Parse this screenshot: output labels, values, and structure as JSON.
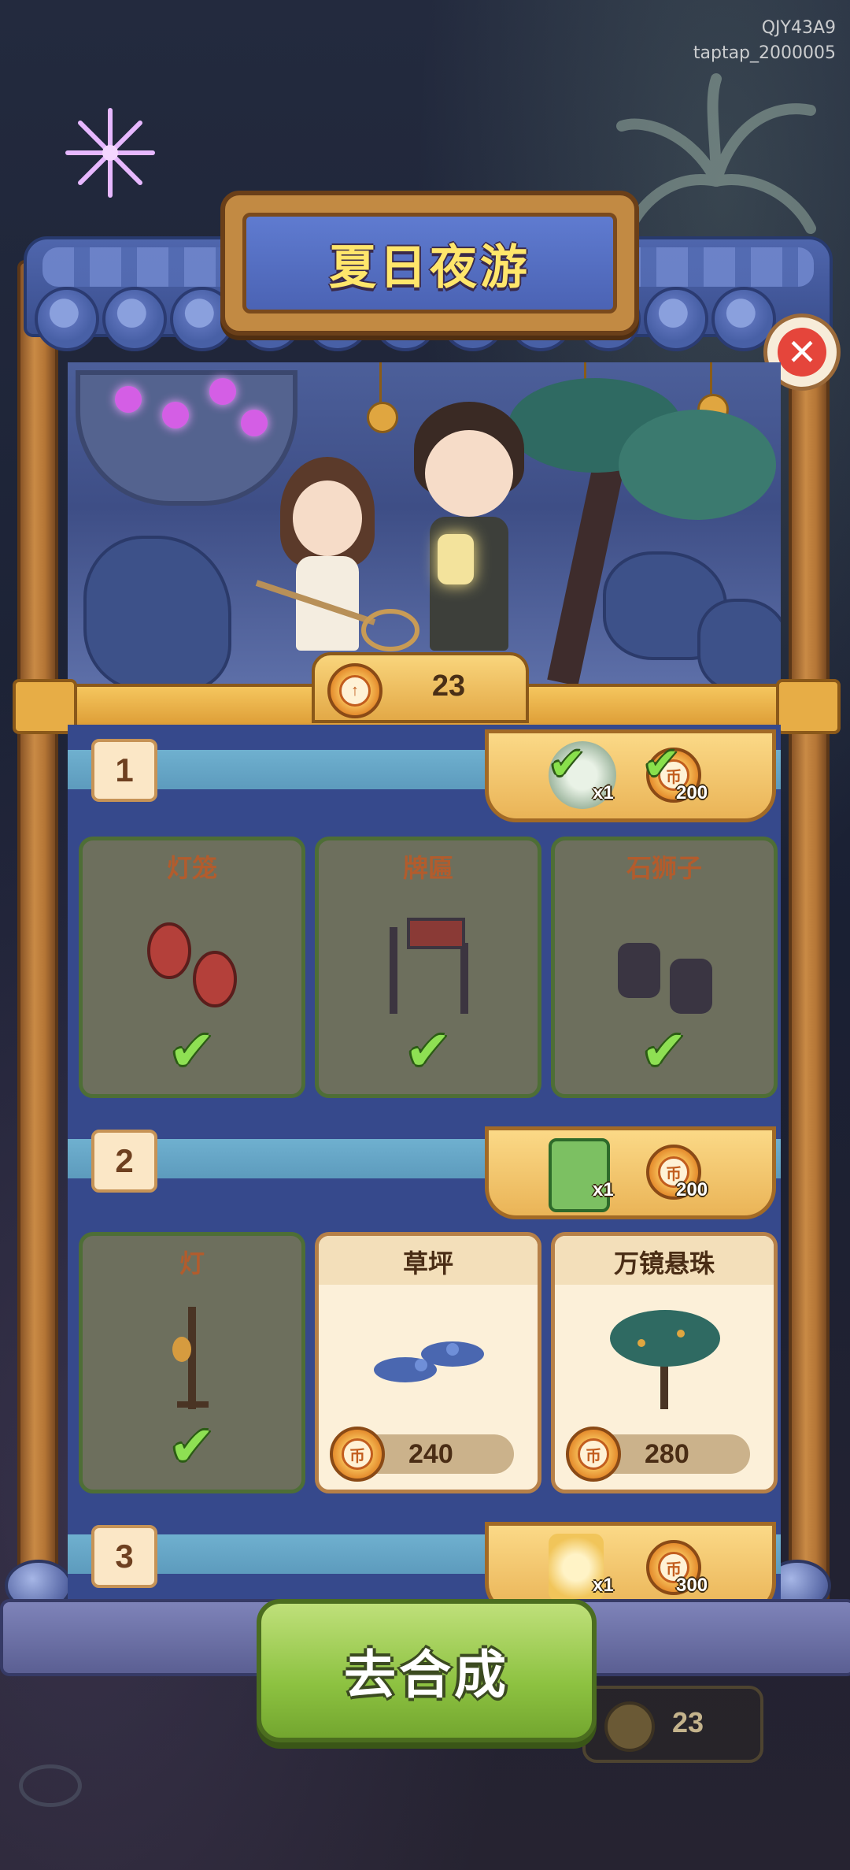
{
  "watermark": {
    "line1": "QJY43A9",
    "line2": "taptap_2000005"
  },
  "title": "夏日夜游",
  "counter": {
    "value": "23"
  },
  "rows": [
    {
      "number": "1",
      "reward": {
        "item_qty": "x1",
        "coin_amount": "200",
        "claimed": true
      },
      "cards": [
        {
          "name": "灯笼",
          "completed": true,
          "icon": "lantern-icon"
        },
        {
          "name": "牌匾",
          "completed": true,
          "icon": "plaque-gate-icon"
        },
        {
          "name": "石狮子",
          "completed": true,
          "icon": "stone-lion-icon"
        }
      ]
    },
    {
      "number": "2",
      "reward": {
        "item_qty": "x1",
        "coin_amount": "200",
        "claimed": false
      },
      "cards": [
        {
          "name": "灯",
          "completed": true,
          "icon": "lamp-post-icon"
        },
        {
          "name": "草坪",
          "completed": false,
          "price": "240",
          "icon": "lawn-icon"
        },
        {
          "name": "万镜悬珠",
          "completed": false,
          "price": "280",
          "icon": "tree-icon"
        }
      ]
    },
    {
      "number": "3",
      "reward": {
        "item_qty": "x1",
        "coin_amount": "300",
        "claimed": false
      }
    }
  ],
  "go_button": {
    "label": "去合成"
  },
  "bottom_counter": {
    "value": "23"
  },
  "colors": {
    "accent": "#ffe66b",
    "panel": "#36498c",
    "go_button": "#8dc241",
    "check": "#89e04c"
  }
}
